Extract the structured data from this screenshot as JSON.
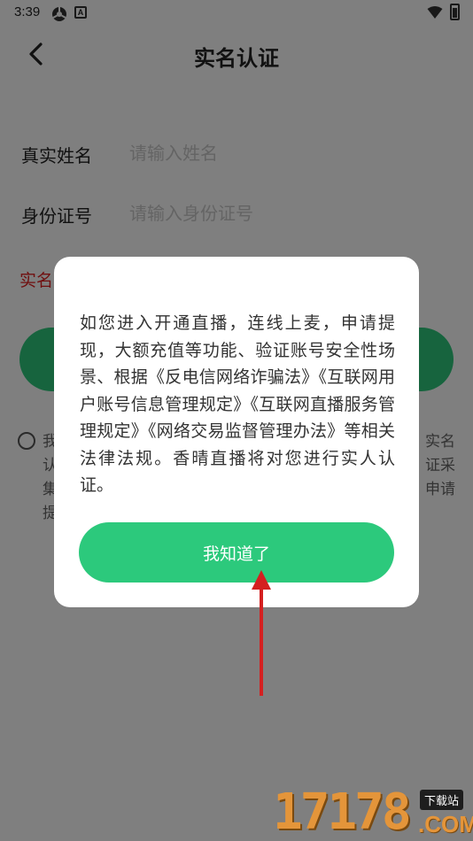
{
  "status_bar": {
    "time": "3:39",
    "app_icon_letter": "A"
  },
  "nav": {
    "title": "实名认证"
  },
  "form": {
    "name_label": "真实姓名",
    "name_placeholder": "请输入姓名",
    "id_label": "身份证号",
    "id_placeholder": "请输入身份证号",
    "notice_partial": "实名"
  },
  "agreement": {
    "left_column": [
      "我",
      "认",
      "集",
      "提"
    ],
    "right_column": [
      "实名",
      "证采",
      "申请"
    ]
  },
  "dialog": {
    "message": "如您进入开通直播，连线上麦，申请提现，大额充值等功能、验证账号安全性场景、根据《反电信网络诈骗法》《互联网用户账号信息管理规定》《互联网直播服务管理规定》《网络交易监督管理办法》等相关法律法规。香晴直播将对您进行实人认证。",
    "confirm_label": "我知道了"
  },
  "watermark": {
    "digits": "17178",
    "tag": "下载站",
    "domain": ".COM"
  },
  "colors": {
    "accent_green": "#2cc97c",
    "annotation_red": "#d42020",
    "notice_red": "#e02020"
  }
}
